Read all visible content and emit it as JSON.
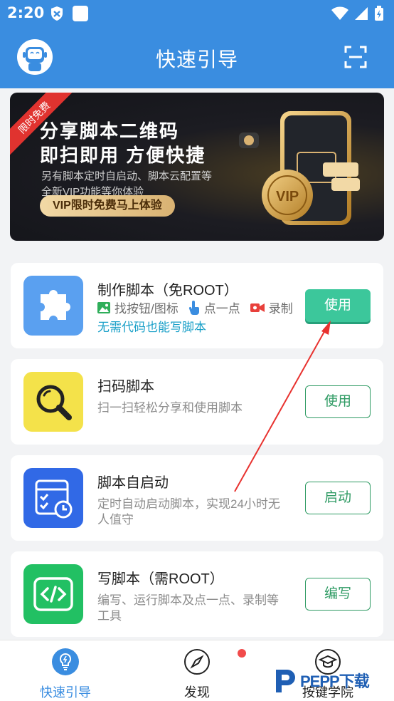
{
  "status_bar": {
    "time": "2:20"
  },
  "header": {
    "title": "快速引导"
  },
  "banner": {
    "ribbon": "限时免费",
    "title_line1": "分享脚本二维码",
    "title_line2": "即扫即用 方便快捷",
    "subtitle_line1": "另有脚本定时自启动、脚本云配置等",
    "subtitle_line2": "全新VIP功能等你体验",
    "cta": "VIP限时免费马上体验"
  },
  "cards": [
    {
      "title": "制作脚本（免ROOT）",
      "features": [
        "找按钮/图标",
        "点一点",
        "录制"
      ],
      "link": "无需代码也能写脚本",
      "button": "使用"
    },
    {
      "title": "扫码脚本",
      "desc": "扫一扫轻松分享和使用脚本",
      "button": "使用"
    },
    {
      "title": "脚本自启动",
      "desc": "定时自动启动脚本，实现24小时无人值守",
      "button": "启动"
    },
    {
      "title": "写脚本（需ROOT）",
      "desc": "编写、运行脚本及点一点、录制等工具",
      "button": "编写"
    }
  ],
  "bottom_nav": [
    {
      "label": "快速引导",
      "active": true
    },
    {
      "label": "发现",
      "active": false
    },
    {
      "label": "按键学院",
      "active": false
    }
  ],
  "watermark": {
    "text": "PEPP下载"
  },
  "colors": {
    "primary": "#3a8de0",
    "accent_green": "#3cc79b",
    "outline_green": "#2f9b64",
    "link_blue": "#1aa0c8",
    "ribbon_red": "#e0332f"
  }
}
